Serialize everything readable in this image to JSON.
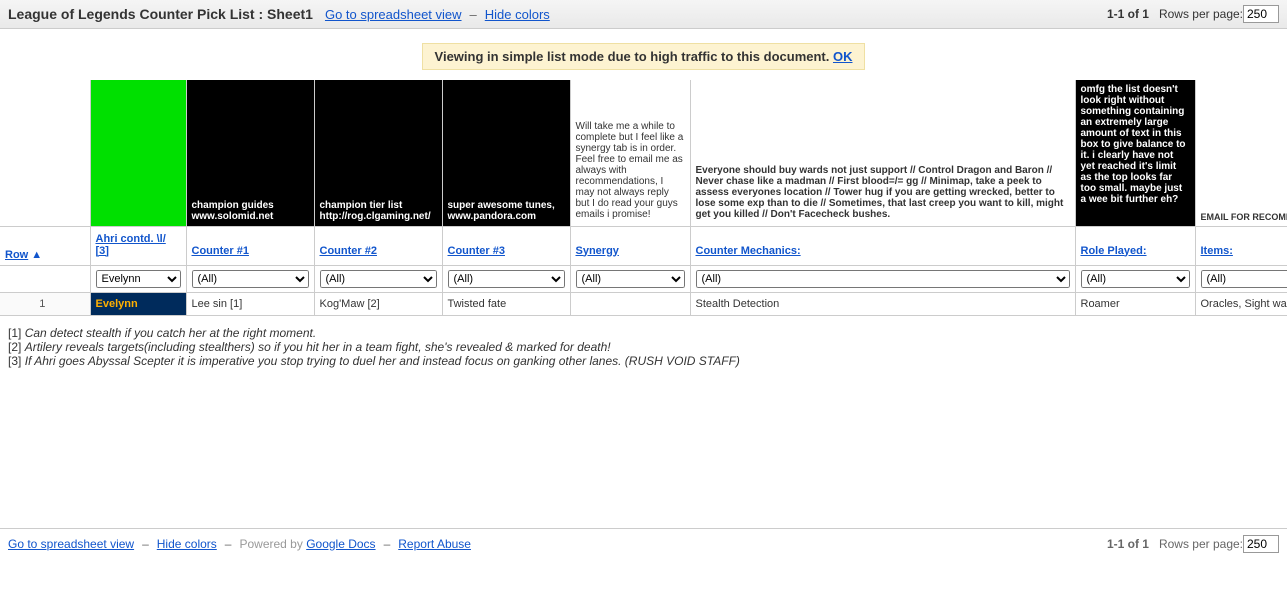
{
  "topbar": {
    "title": "League of Legends Counter Pick List : Sheet1",
    "go_link": "Go to spreadsheet view",
    "sep": "–",
    "hide_link": "Hide colors",
    "pager": "1-1 of 1",
    "rpp_label": "Rows per page:",
    "rpp_value": "250"
  },
  "notice": {
    "text": "Viewing in simple list mode due to high traffic to this document. ",
    "ok": "OK"
  },
  "descs": {
    "c1": "champion guides www.solomid.net",
    "c2": "champion tier list http://rog.clgaming.net/",
    "c3": "super awesome tunes, www.pandora.com",
    "syn": "Will take me a while to complete but I feel like a synergy tab is in order. Feel free to email me as always with recommendations, I may not always reply but I do read your guys emails i promise!",
    "mech": "Everyone should buy wards not just support // Control Dragon and Baron // Never chase like a madman // First blood=/= gg // Minimap, take a peek to assess everyones location // Tower hug if you are getting wrecked, better to lose some exp than to die // Sometimes, that last creep you want to kill, might get you killed // Don't Facecheck bushes.",
    "role": "omfg the list doesn't look right without something containing an extremely large amount of text in this box to give balance to it. i clearly have not yet reached it's limit as the top looks far too small. maybe just a wee bit further eh?",
    "items": "EMAIL FOR RECOMMENDATIONS THISISMY"
  },
  "headers": {
    "row": "Row",
    "arrow": "▲",
    "c0a": "Ahri contd. \\l/",
    "c0b": "[3]",
    "c1": "Counter #1",
    "c2": "Counter #2",
    "c3": "Counter #3",
    "syn": "Synergy",
    "mech": "Counter Mechanics:",
    "role": "Role Played:",
    "items": "Items:"
  },
  "filters": {
    "c0": "Evelynn",
    "all": "(All)"
  },
  "row": {
    "num": "1",
    "c0": "Evelynn",
    "c1": "Lee sin   [1]",
    "c2": "Kog'Maw   [2]",
    "c3": "Twisted fate",
    "syn": "",
    "mech": "Stealth Detection",
    "role": "Roamer",
    "items": "Oracles, Sight wards"
  },
  "footnotes": {
    "f1n": "[1] ",
    "f1": "Can detect stealth if you catch her at the right moment.",
    "f2n": "[2] ",
    "f2": "Artilery reveals targets(including stealthers) so if you hit her in a team fight, she's revealed & marked for death!",
    "f3n": "[3] ",
    "f3": "If Ahri goes Abyssal Scepter it is imperative you stop trying to duel her and instead focus on ganking other lanes. (RUSH VOID STAFF)"
  },
  "bottom": {
    "go_link": "Go to spreadsheet view",
    "hide_link": "Hide colors",
    "powered": "Powered by ",
    "gdocs": "Google Docs",
    "report": "Report Abuse",
    "pager": "1-1 of 1",
    "rpp_label": "Rows per page:",
    "rpp_value": "250"
  }
}
